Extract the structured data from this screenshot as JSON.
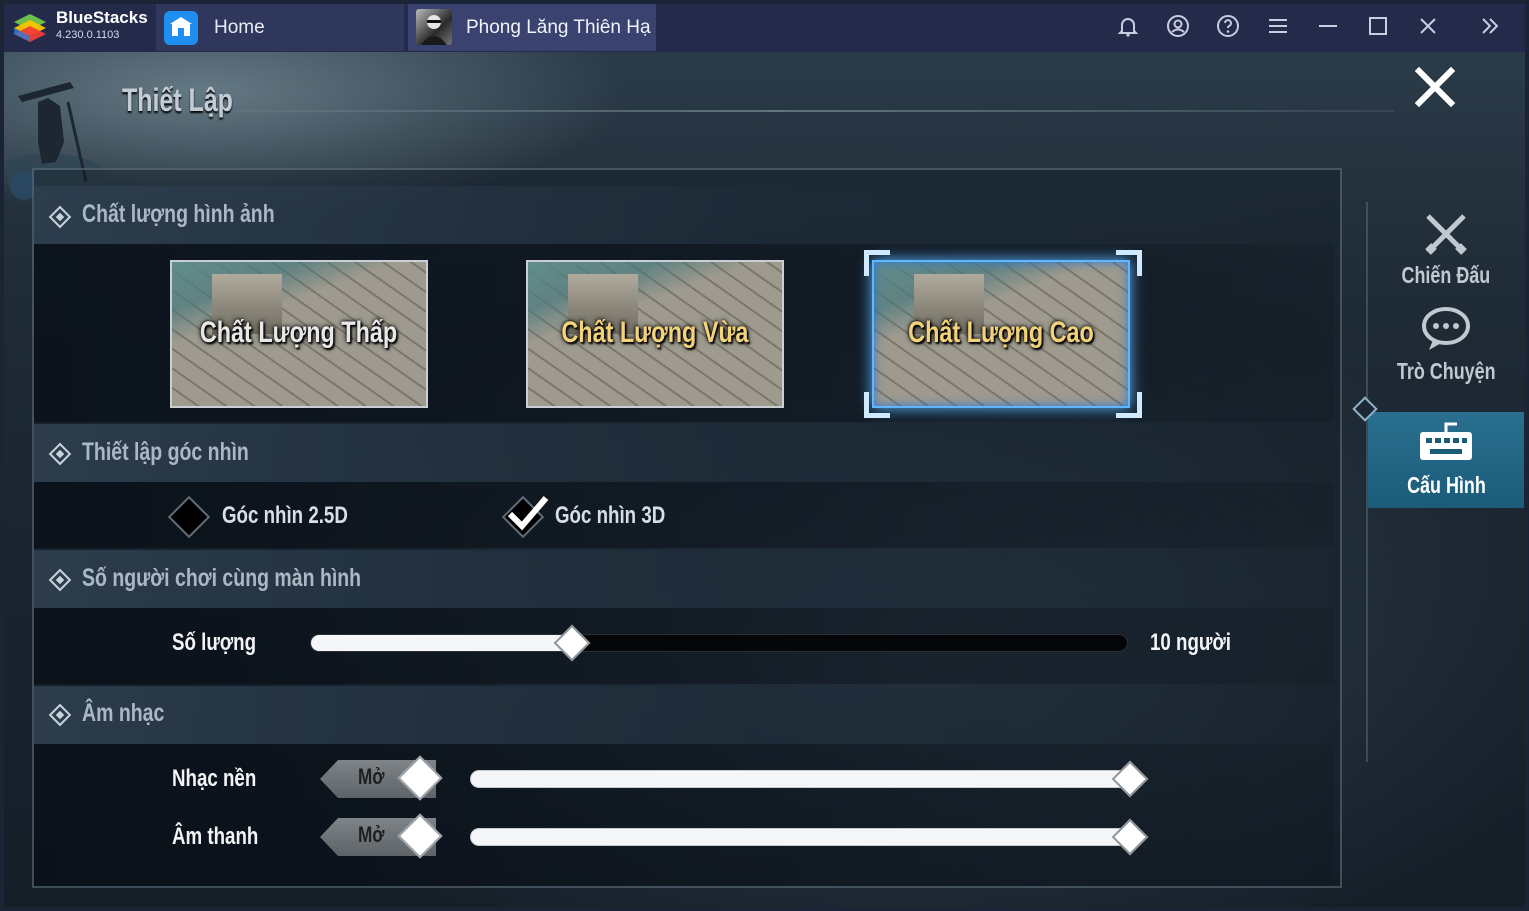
{
  "app": {
    "brand_name": "BlueStacks",
    "version": "4.230.0.1103",
    "tabs": [
      {
        "label": "Home"
      },
      {
        "label": "Phong Lăng Thiên Hạ"
      }
    ],
    "toolbar_icons": [
      "bell-icon",
      "account-icon",
      "help-icon",
      "menu-icon",
      "minimize-icon",
      "maximize-icon",
      "close-icon",
      "expand-sidebar-icon"
    ]
  },
  "settings": {
    "title": "Thiết Lập",
    "sections": {
      "graphics": {
        "title": "Chất lượng hình ảnh",
        "options": [
          {
            "label": "Chất Lượng Thấp",
            "selected": false
          },
          {
            "label": "Chất Lượng Vừa",
            "selected": false
          },
          {
            "label": "Chất Lượng Cao",
            "selected": true
          }
        ]
      },
      "camera": {
        "title": "Thiết lập góc nhìn",
        "options": [
          {
            "label": "Góc nhìn 2.5D",
            "checked": false
          },
          {
            "label": "Góc nhìn 3D",
            "checked": true
          }
        ]
      },
      "players": {
        "title": "Số người chơi cùng màn hình",
        "row_label": "Số lượng",
        "value_label": "10 người",
        "slider_fraction": 0.32
      },
      "music": {
        "title": "Âm nhạc",
        "rows": [
          {
            "label": "Nhạc nền",
            "toggle": "Mở",
            "level": 1.0
          },
          {
            "label": "Âm thanh",
            "toggle": "Mở",
            "level": 1.0
          }
        ]
      }
    },
    "sidebar": [
      {
        "label": "Chiến Đấu",
        "icon": "crossed-swords-icon",
        "active": false
      },
      {
        "label": "Trò Chuyện",
        "icon": "chat-bubble-icon",
        "active": false
      },
      {
        "label": "Cấu Hình",
        "icon": "keyboard-icon",
        "active": true
      }
    ]
  },
  "colors": {
    "titlebar": "#232a4a",
    "accent_blue": "#58b4ff",
    "active_tab": "#1b5c79",
    "gold_text": "#f2d27a"
  }
}
